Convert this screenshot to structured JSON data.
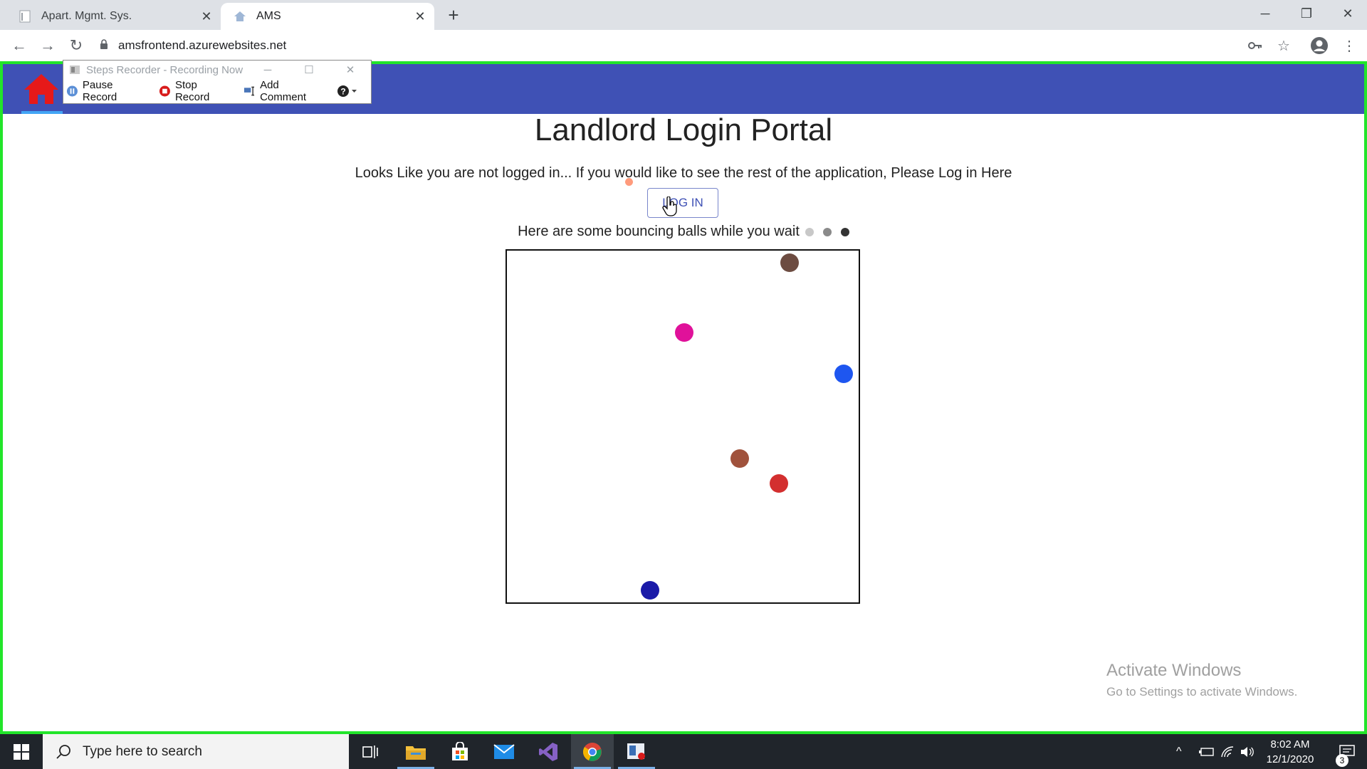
{
  "browser": {
    "tabs": [
      {
        "label": "Apart. Mgmt. Sys.",
        "active": false
      },
      {
        "label": "AMS",
        "active": true
      }
    ],
    "url": "amsfrontend.azurewebsites.net"
  },
  "page": {
    "title": "Landlord Login Portal",
    "message": "Looks Like you are not logged in... If you would like to see the rest of the application, Please Log in Here",
    "login_button": "LOG IN",
    "wait_text": "Here are some bouncing balls while you wait",
    "loading_dot_colors": [
      "#c8c8c8",
      "#8a8a8a",
      "#333333"
    ],
    "appbar_color": "#3f51b5",
    "balls": [
      {
        "color": "#6d4c41"
      },
      {
        "color": "#e0119a"
      },
      {
        "color": "#1e56f0"
      },
      {
        "color": "#a0523c"
      },
      {
        "color": "#d32f2f"
      },
      {
        "color": "#1a1aa8"
      }
    ]
  },
  "steps_recorder": {
    "title": "Steps Recorder - Recording Now",
    "pause": "Pause Record",
    "stop": "Stop Record",
    "comment": "Add Comment"
  },
  "watermark": {
    "line1": "Activate Windows",
    "line2": "Go to Settings to activate Windows."
  },
  "taskbar": {
    "search_placeholder": "Type here to search",
    "time": "8:02 AM",
    "date": "12/1/2020",
    "notifications": "3"
  }
}
